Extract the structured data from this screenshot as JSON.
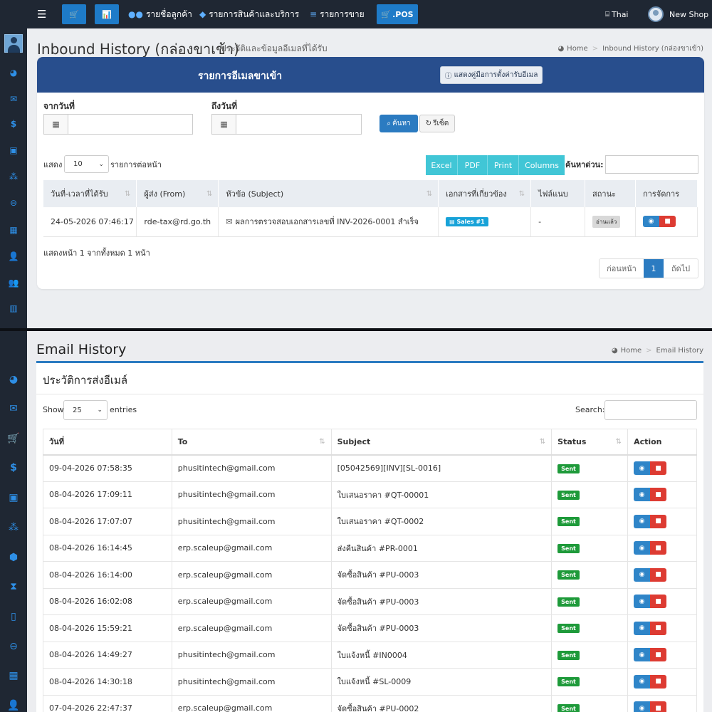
{
  "topbar": {
    "menu_icon": "☰",
    "cart_icon": "🛒",
    "chart_icon": "📊",
    "customers": "รายชื่อลูกค้า",
    "products": "รายการสินค้าและบริการ",
    "sales": "รายการขาย",
    "pos": ".POS",
    "lang": "Thai",
    "shop": "New Shop"
  },
  "inbound": {
    "title": "Inbound History (กล่องขาเข้า)",
    "subtitle": "ประวัติและข้อมูลอีเมลที่ได้รับ",
    "crumb_home": "Home",
    "crumb_current": "Inbound History (กล่องขาเข้า)",
    "card_title": "รายการอีเมลขาเข้า",
    "guide_button": "แสดงคู่มือการตั้งค่ารับอีเมล",
    "from_label": "จากวันที่",
    "to_label": "ถึงวันที่",
    "search_button": "ค้นหา",
    "reset_button": "รีเซ็ต",
    "show_label": "แสดง",
    "page_size": "10",
    "per_page_label": "รายการต่อหน้า",
    "export_buttons": [
      "Excel",
      "PDF",
      "Print",
      "Columns"
    ],
    "quick_search_label": "ค้นหาด่วน:",
    "columns": [
      "วันที่-เวลาที่ได้รับ",
      "ผู้ส่ง (From)",
      "หัวข้อ (Subject)",
      "เอกสารที่เกี่ยวข้อง",
      "ไฟล์แนบ",
      "สถานะ",
      "การจัดการ"
    ],
    "rows": [
      {
        "date": "24-05-2026 07:46:17",
        "from": "rde-tax@rd.go.th",
        "subject": "ผลการตรวจสอบเอกสารเลขที่ INV-2026-0001 สำเร็จ",
        "doc": "Sales #1",
        "attach": "-",
        "status": "อ่านแล้ว"
      }
    ],
    "footer_info": "แสดงหน้า 1 จากทั้งหมด 1 หน้า",
    "pager": {
      "prev": "ก่อนหน้า",
      "current": "1",
      "next": "ถัดไป"
    }
  },
  "email_history": {
    "title": "Email History",
    "crumb_home": "Home",
    "crumb_current": "Email History",
    "card_title": "ประวัติการส่งอีเมล์",
    "show_label": "Show",
    "page_size": "25",
    "entries_label": "entries",
    "search_label": "Search:",
    "columns": [
      "วันที่",
      "To",
      "Subject",
      "Status",
      "Action"
    ],
    "rows": [
      {
        "date": "09-04-2026 07:58:35",
        "to": "phusitintech@gmail.com",
        "subject": "[05042569][INV][SL-0016]",
        "status": "Sent"
      },
      {
        "date": "08-04-2026 17:09:11",
        "to": "phusitintech@gmail.com",
        "subject": "ใบเสนอราคา #QT-00001",
        "status": "Sent"
      },
      {
        "date": "08-04-2026 17:07:07",
        "to": "phusitintech@gmail.com",
        "subject": "ใบเสนอราคา #QT-0002",
        "status": "Sent"
      },
      {
        "date": "08-04-2026 16:14:45",
        "to": "erp.scaleup@gmail.com",
        "subject": "ส่งคืนสินค้า #PR-0001",
        "status": "Sent"
      },
      {
        "date": "08-04-2026 16:14:00",
        "to": "erp.scaleup@gmail.com",
        "subject": "จัดซื้อสินค้า #PU-0003",
        "status": "Sent"
      },
      {
        "date": "08-04-2026 16:02:08",
        "to": "erp.scaleup@gmail.com",
        "subject": "จัดซื้อสินค้า #PU-0003",
        "status": "Sent"
      },
      {
        "date": "08-04-2026 15:59:21",
        "to": "erp.scaleup@gmail.com",
        "subject": "จัดซื้อสินค้า #PU-0003",
        "status": "Sent"
      },
      {
        "date": "08-04-2026 14:49:27",
        "to": "phusitintech@gmail.com",
        "subject": "ใบแจ้งหนี้ #IN0004",
        "status": "Sent"
      },
      {
        "date": "08-04-2026 14:30:18",
        "to": "phusitintech@gmail.com",
        "subject": "ใบแจ้งหนี้ #SL-0009",
        "status": "Sent"
      },
      {
        "date": "07-04-2026 22:47:37",
        "to": "erp.scaleup@gmail.com",
        "subject": "จัดซื้อสินค้า #PU-0002",
        "status": "Sent"
      }
    ]
  },
  "colors": {
    "topbar": "#1f2733",
    "primary": "#2b7bc1",
    "header_blue": "#284e8d",
    "teal": "#41c6d6",
    "sent_green": "#1e9a3a",
    "delete_red": "#dd3b32"
  }
}
